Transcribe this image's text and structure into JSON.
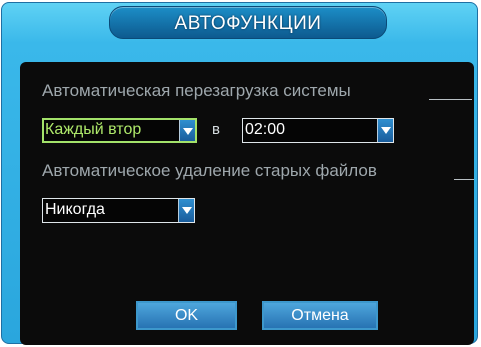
{
  "dialog": {
    "title": "АВТОФУНКЦИИ"
  },
  "reboot": {
    "label": "Автоматическая перезагрузка системы",
    "day_value": "Каждый втор",
    "at_label": "в",
    "time_value": "02:00"
  },
  "delete_old": {
    "label": "Автоматическое удаление старых файлов",
    "value": "Никогда"
  },
  "buttons": {
    "ok": "OK",
    "cancel": "Отмена"
  },
  "colors": {
    "window_blue": "#3ab8ea",
    "panel_black": "#0b0b0b",
    "active_green": "#aee86a",
    "button_blue": "#2f86c4"
  },
  "icons": {
    "dropdown": "chevron-down-icon"
  }
}
